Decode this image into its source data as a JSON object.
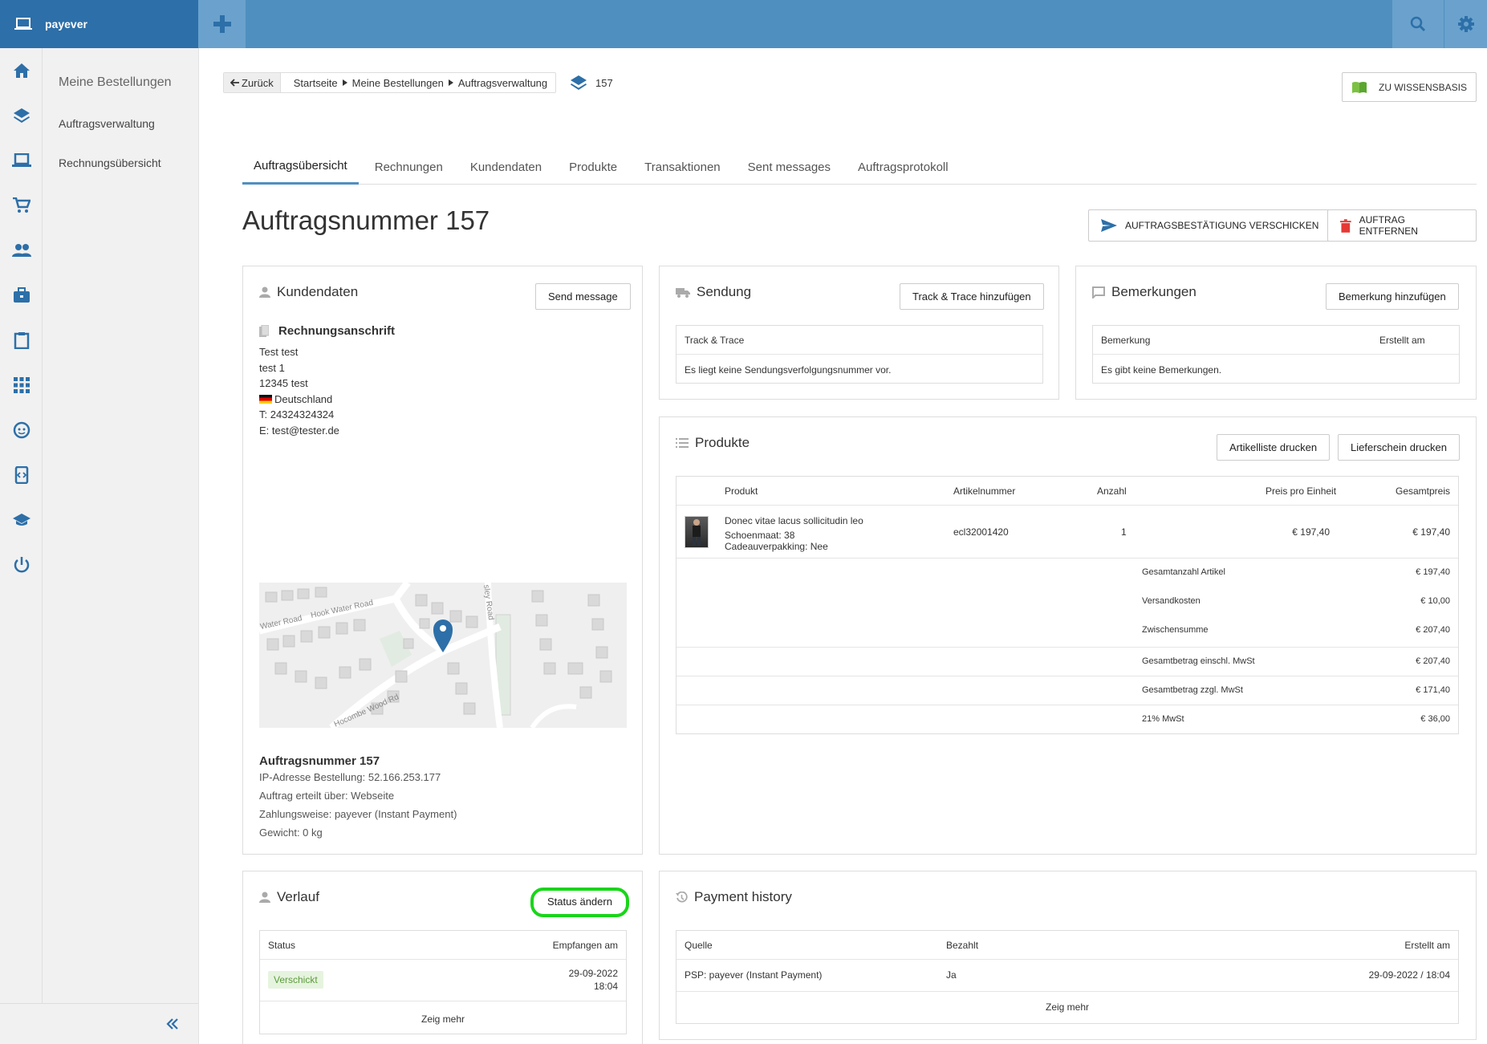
{
  "app": {
    "brand": "payever"
  },
  "sidebar": {
    "items": [
      {
        "label": "Meine Bestellungen"
      },
      {
        "label": "Auftragsverwaltung"
      },
      {
        "label": "Rechnungsübersicht"
      }
    ]
  },
  "breadcrumb": {
    "back": "Zurück",
    "crumbs": [
      "Startseite",
      "Meine Bestellungen",
      "Auftragsverwaltung"
    ],
    "number": "157"
  },
  "knowledge_button": "ZU WISSENSBASIS",
  "tabs": [
    "Auftragsübersicht",
    "Rechnungen",
    "Kundendaten",
    "Produkte",
    "Transaktionen",
    "Sent messages",
    "Auftragsprotokoll"
  ],
  "page_title": "Auftragsnummer 157",
  "actions": {
    "send_confirmation": "AUFTRAGSBESTÄTIGUNG VERSCHICKEN",
    "remove_order": "AUFTRAG ENTFERNEN"
  },
  "customer": {
    "title": "Kundendaten",
    "send_message": "Send message",
    "billing_title": "Rechnungsanschrift",
    "lines": [
      "Test test",
      "test 1",
      "12345 test",
      "Deutschland",
      "T: 24324324324",
      "E: test@tester.de"
    ],
    "map_labels": [
      "Water Road",
      "Hook Water Road",
      "Hocombe Wood Rd",
      "sley Road"
    ],
    "order_title": "Auftragsnummer 157",
    "details": [
      "IP-Adresse Bestellung: 52.166.253.177",
      "Auftrag erteilt über: Webseite",
      "Zahlungsweise: payever (Instant Payment)",
      "Gewicht: 0 kg"
    ]
  },
  "shipping": {
    "title": "Sendung",
    "button": "Track & Trace hinzufügen",
    "col": "Track & Trace",
    "empty": "Es liegt keine Sendungsverfolgungsnummer vor."
  },
  "remarks": {
    "title": "Bemerkungen",
    "button": "Bemerkung hinzufügen",
    "col_remark": "Bemerkung",
    "col_created": "Erstellt am",
    "empty": "Es gibt keine Bemerkungen."
  },
  "products": {
    "title": "Produkte",
    "btn_list": "Artikelliste drucken",
    "btn_delivery": "Lieferschein drucken",
    "cols": [
      "Produkt",
      "Artikelnummer",
      "Anzahl",
      "Preis pro Einheit",
      "Gesamtpreis"
    ],
    "item": {
      "name": "Donec vitae lacus sollicitudin leo",
      "meta1": "Schoenmaat: 38",
      "meta2": "Cadeauverpakking: Nee",
      "sku": "ecl32001420",
      "qty": "1",
      "unit": "€ 197,40",
      "total": "€ 197,40"
    },
    "summary": [
      {
        "label": "Gesamtanzahl Artikel",
        "value": "€ 197,40"
      },
      {
        "label": "Versandkosten",
        "value": "€ 10,00"
      },
      {
        "label": "Zwischensumme",
        "value": "€ 207,40"
      },
      {
        "label": "Gesamtbetrag einschl. MwSt",
        "value": "€ 207,40"
      },
      {
        "label": "Gesamtbetrag zzgl. MwSt",
        "value": "€ 171,40"
      },
      {
        "label": "21% MwSt",
        "value": "€ 36,00"
      }
    ]
  },
  "history": {
    "title": "Verlauf",
    "button": "Status ändern",
    "col_status": "Status",
    "col_received": "Empfangen am",
    "status": "Verschickt",
    "date": "29-09-2022",
    "time": "18:04",
    "more": "Zeig mehr"
  },
  "payment": {
    "title": "Payment history",
    "cols": [
      "Quelle",
      "Bezahlt",
      "Erstellt am"
    ],
    "row": {
      "source": "PSP: payever (Instant Payment)",
      "paid": "Ja",
      "created": "29-09-2022 / 18:04"
    },
    "more": "Zeig mehr"
  },
  "colors": {
    "accent": "#4f8fc0",
    "brand_dark": "#2d6fa8",
    "danger": "#e53935",
    "success_text": "#5b9b3a",
    "highlight": "#1ad51a"
  }
}
